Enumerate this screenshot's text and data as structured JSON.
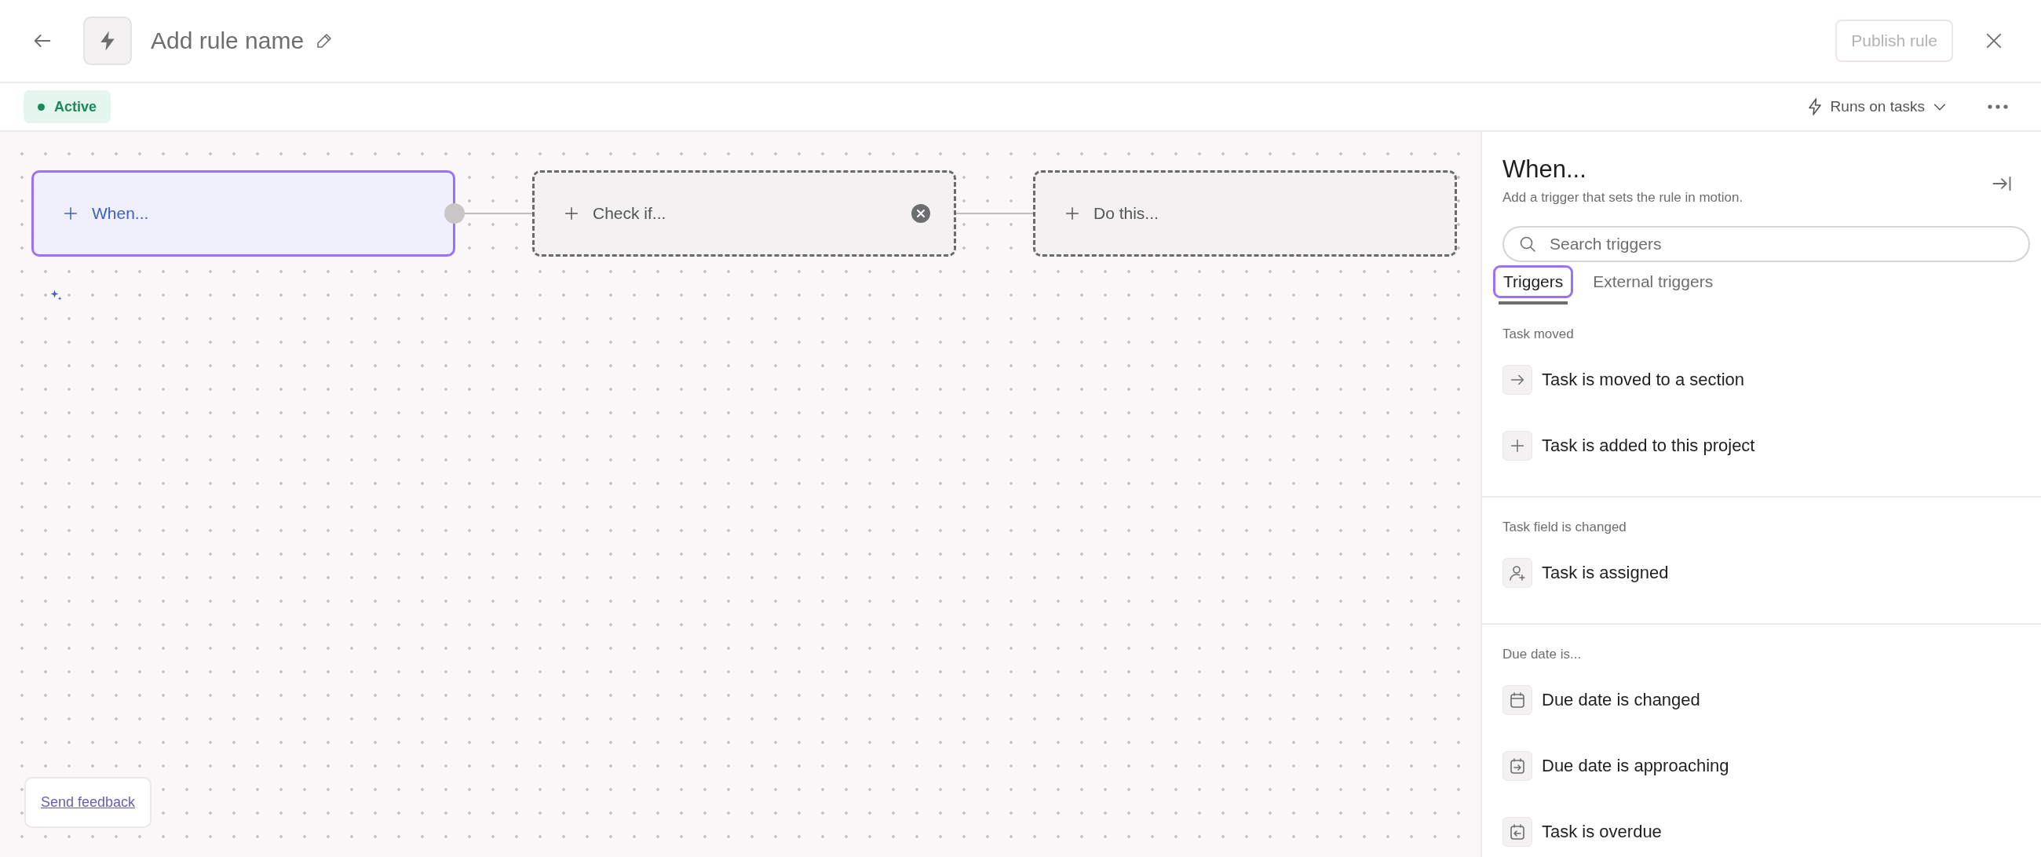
{
  "header": {
    "title": "Add rule name",
    "publish_button": {
      "label": "Publish rule",
      "disabled": true
    }
  },
  "toolbar": {
    "status": {
      "label": "Active",
      "color": "#1a8a5a"
    },
    "runs_on": "Runs on tasks"
  },
  "canvas": {
    "nodes": [
      {
        "label": "When...",
        "selected": true,
        "removable": false
      },
      {
        "label": "Check if...",
        "selected": false,
        "removable": true
      },
      {
        "label": "Do this...",
        "selected": false,
        "removable": false
      }
    ],
    "feedback_link": "Send feedback"
  },
  "panel": {
    "title": "When...",
    "subtitle": "Add a trigger that sets the rule in motion.",
    "search": {
      "placeholder": "Search triggers"
    },
    "tabs": [
      {
        "label": "Triggers",
        "selected": true
      },
      {
        "label": "External triggers",
        "selected": false
      }
    ],
    "sections": [
      {
        "heading": "Task moved",
        "items": [
          {
            "label": "Task is moved to a section",
            "kind": "arrow"
          },
          {
            "label": "Task is added to this project",
            "kind": "plus"
          }
        ]
      },
      {
        "heading": "Task field is changed",
        "items": [
          {
            "label": "Task is assigned",
            "kind": "person"
          }
        ]
      },
      {
        "heading": "Due date is...",
        "items": [
          {
            "label": "Due date is changed",
            "kind": "calendar"
          },
          {
            "label": "Due date is approaching",
            "kind": "calendar-in"
          },
          {
            "label": "Task is overdue",
            "kind": "calendar-out"
          }
        ]
      }
    ]
  }
}
